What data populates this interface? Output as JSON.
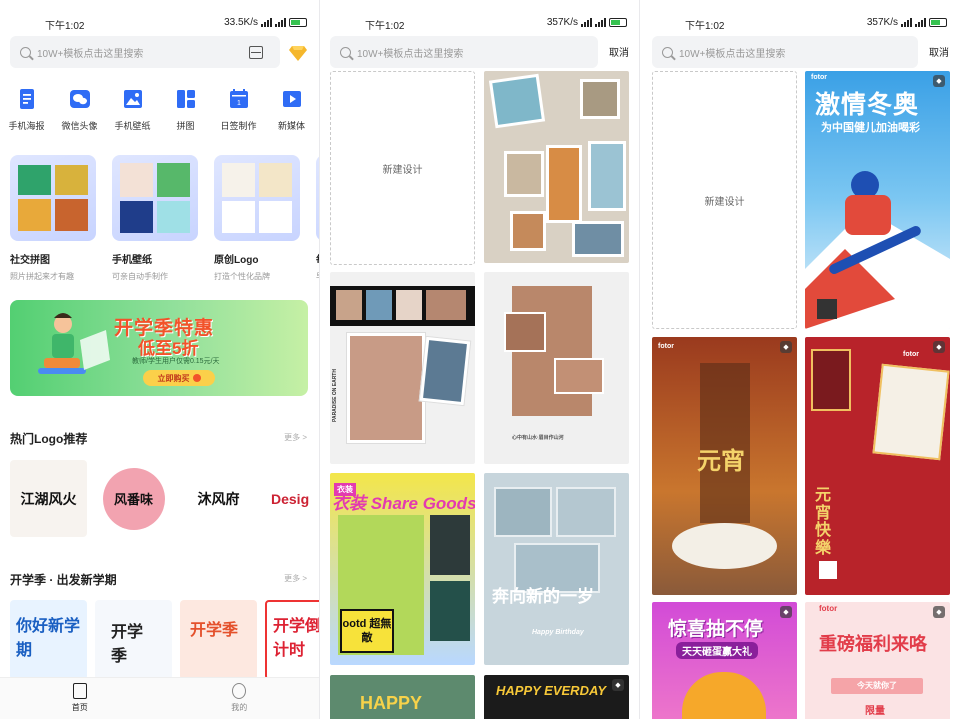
{
  "status": {
    "time": "下午1:02",
    "speed1": "33.5K/s",
    "speed2": "357K/s",
    "speed3": "357K/s",
    "battery": "78"
  },
  "home": {
    "search_placeholder": "10W+模板点击这里搜索",
    "tools": [
      {
        "label": "手机海报",
        "icon": "phone-poster-icon"
      },
      {
        "label": "微信头像",
        "icon": "wechat-avatar-icon"
      },
      {
        "label": "手机壁纸",
        "icon": "wallpaper-icon"
      },
      {
        "label": "拼图",
        "icon": "collage-icon"
      },
      {
        "label": "日签制作",
        "icon": "calendar-icon"
      },
      {
        "label": "新媒体",
        "icon": "play-icon"
      }
    ],
    "categories": [
      {
        "title": "社交拼图",
        "subtitle": "照片拼起来才有趣"
      },
      {
        "title": "手机壁纸",
        "subtitle": "可亲自动手制作"
      },
      {
        "title": "原创Logo",
        "subtitle": "打造个性化品牌"
      },
      {
        "title": "每日",
        "subtitle": "早安"
      }
    ],
    "banner": {
      "headline": "开学季特惠",
      "subhead": "低至5折",
      "note": "教师/学生用户仅需0.15元/天",
      "button": "立即购买"
    },
    "logo_section": {
      "title": "热门Logo推荐",
      "more": "更多 >"
    },
    "logos": [
      "江湖风火",
      "风番味",
      "沐风府",
      "Desig"
    ],
    "school_section": {
      "title": "开学季 · 出发新学期",
      "more": "更多 >"
    },
    "school_posters": [
      "你好新学期",
      "开学季",
      "开学季",
      "开学倒计时"
    ],
    "tabs": [
      {
        "label": "首页"
      },
      {
        "label": "我的"
      }
    ]
  },
  "search_page_1": {
    "search_placeholder": "10W+模板点击这里搜索",
    "cancel": "取消",
    "new_design": "新建设计",
    "tiles": [
      {
        "text": ""
      },
      {
        "text": "PARADISE ON EARTH"
      },
      {
        "text": "心中有山水·眉目作山河"
      },
      {
        "text": "衣装 Share Goods"
      },
      {
        "text": "ootd 超無敵"
      },
      {
        "text": "奔向新的一岁"
      },
      {
        "text": "Happy Birthday"
      },
      {
        "text": "HAPPY"
      },
      {
        "text": "HAPPY EVERDAY"
      }
    ]
  },
  "search_page_2": {
    "search_placeholder": "10W+模板点击这里搜索",
    "cancel": "取消",
    "new_design": "新建设计",
    "tiles": [
      {
        "text": "激情冬奥"
      },
      {
        "text": "为中国健儿加油喝彩"
      },
      {
        "text": "元宵"
      },
      {
        "text": "元宵快樂"
      },
      {
        "text": "惊喜抽不停"
      },
      {
        "text": "天天砸蛋赢大礼"
      },
      {
        "text": "重磅福利来咯"
      },
      {
        "text": "今天就你了"
      },
      {
        "text": "限量"
      }
    ],
    "brand": "fotor"
  },
  "colors": {
    "accent_orange": "#f2532a",
    "banner_green": "#53cf72",
    "icon_blue": "#2f6cf5"
  }
}
